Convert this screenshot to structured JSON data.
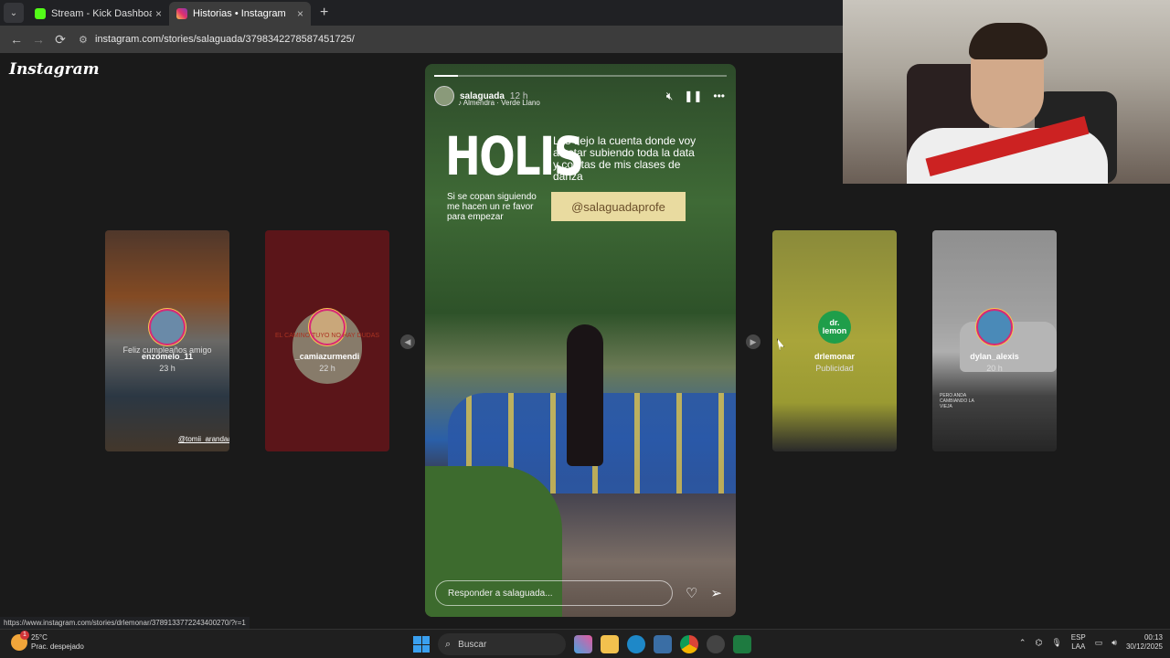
{
  "browser": {
    "tabs": [
      {
        "title": "Stream - Kick Dashboard",
        "close": "×"
      },
      {
        "title": "Historias • Instagram",
        "close": "×"
      }
    ],
    "new_tab": "+",
    "url": "instagram.com/stories/salaguada/3798342278587451725/",
    "status_url": "https://www.instagram.com/stories/drlemonar/3789133772243400270/?r=1"
  },
  "instagram": {
    "logo": "Instagram",
    "story": {
      "username": "salaguada",
      "time": "12 h",
      "music": "Almendra · Verde Llano",
      "progress": 0.08,
      "headline": "HOLIS",
      "text": "Les dejo la cuenta donde voy a estar subiendo toda la data y cositas de mis clases de danza",
      "subtext": "Si se copan siguiendo me hacen un re favor para empezar",
      "handle": "@salaguadaprofe",
      "reply_placeholder": "Responder a salaguada..."
    },
    "previews": [
      {
        "name": "enzomelo_11",
        "age": "23 h",
        "caption": "Feliz cumpleaños amigo",
        "tag": "@tomii_arandaa"
      },
      {
        "name": "_camiazurmendi",
        "age": "22 h",
        "caption": "EL CAMINO TUYO NO HAY DUDAS"
      },
      {
        "name": "drlemonar",
        "age": "Publicidad",
        "logo_text": "dr. lemon"
      },
      {
        "name": "dylan_alexis",
        "age": "20 h",
        "caption": "PERO ANDA CAMBIANDO LA VIEJA"
      }
    ]
  },
  "taskbar": {
    "weather_temp": "25°C",
    "weather_desc": "Prac. despejado",
    "weather_badge": "1",
    "search": "Buscar",
    "lang1": "ESP",
    "lang2": "LAA",
    "time": "00:13",
    "date": "30/12/2025"
  }
}
